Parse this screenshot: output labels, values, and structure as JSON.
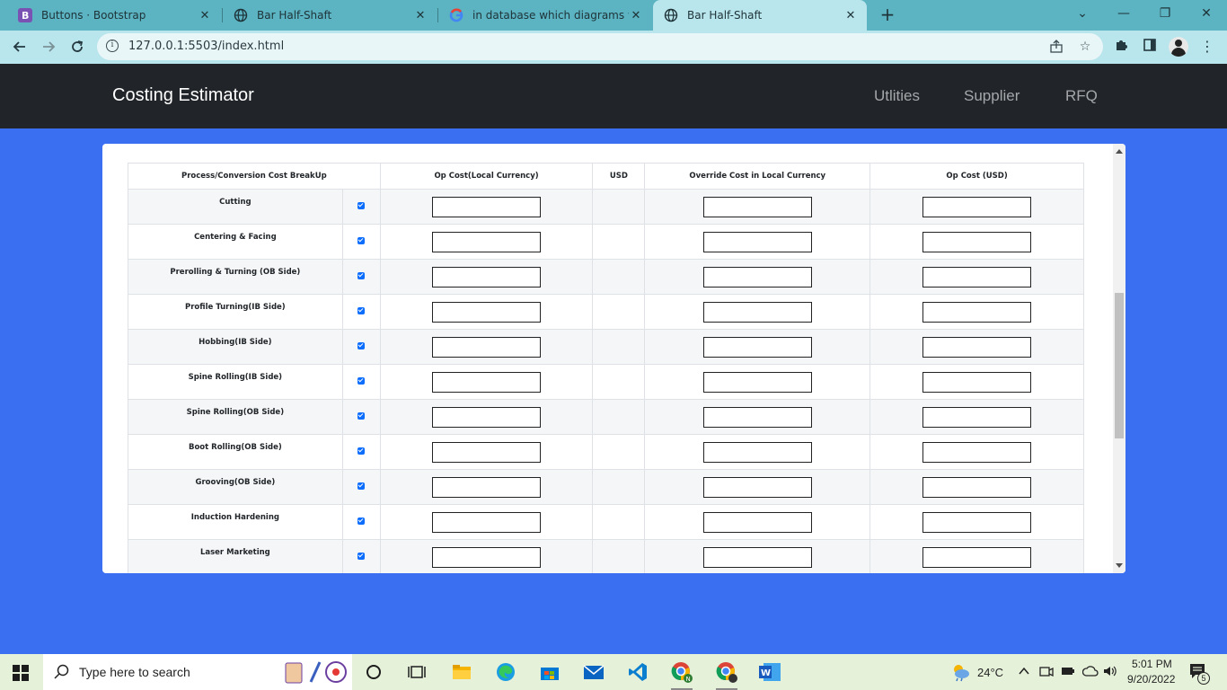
{
  "browser": {
    "tabs": [
      {
        "title": "Buttons · Bootstrap",
        "icon": "bootstrap-icon",
        "active": false
      },
      {
        "title": "Bar Half-Shaft",
        "icon": "globe-icon",
        "active": false
      },
      {
        "title": "in database which diagrams we w",
        "icon": "google-icon",
        "active": false
      },
      {
        "title": "Bar Half-Shaft",
        "icon": "globe-icon",
        "active": true
      }
    ],
    "close_glyph": "✕",
    "new_tab_glyph": "+",
    "controls": {
      "list": "⌄",
      "minimize": "—",
      "restore": "❐",
      "close": "✕"
    },
    "url": "127.0.0.1:5503/index.html",
    "info_glyph": "i"
  },
  "navbar": {
    "brand": "Costing Estimator",
    "links": [
      "Utlities",
      "Supplier",
      "RFQ"
    ]
  },
  "table": {
    "headers": {
      "process": "Process/Conversion Cost BreakUp",
      "op_cost_local": "Op Cost(Local Currency)",
      "usd": "USD",
      "override": "Override Cost in Local Currency",
      "op_cost_usd": "Op Cost (USD)"
    },
    "rows": [
      {
        "process": "Cutting",
        "checked": true,
        "op_cost_local": "",
        "usd": "",
        "override": "",
        "op_cost_usd": ""
      },
      {
        "process": "Centering & Facing",
        "checked": true,
        "op_cost_local": "",
        "usd": "",
        "override": "",
        "op_cost_usd": ""
      },
      {
        "process": "Prerolling & Turning (OB Side)",
        "checked": true,
        "op_cost_local": "",
        "usd": "",
        "override": "",
        "op_cost_usd": ""
      },
      {
        "process": "Profile Turning(IB Side)",
        "checked": true,
        "op_cost_local": "",
        "usd": "",
        "override": "",
        "op_cost_usd": ""
      },
      {
        "process": "Hobbing(IB Side)",
        "checked": true,
        "op_cost_local": "",
        "usd": "",
        "override": "",
        "op_cost_usd": ""
      },
      {
        "process": "Spine Rolling(IB Side)",
        "checked": true,
        "op_cost_local": "",
        "usd": "",
        "override": "",
        "op_cost_usd": ""
      },
      {
        "process": "Spine Rolling(OB Side)",
        "checked": true,
        "op_cost_local": "",
        "usd": "",
        "override": "",
        "op_cost_usd": ""
      },
      {
        "process": "Boot Rolling(OB Side)",
        "checked": true,
        "op_cost_local": "",
        "usd": "",
        "override": "",
        "op_cost_usd": ""
      },
      {
        "process": "Grooving(OB Side)",
        "checked": true,
        "op_cost_local": "",
        "usd": "",
        "override": "",
        "op_cost_usd": ""
      },
      {
        "process": "Induction Hardening",
        "checked": true,
        "op_cost_local": "",
        "usd": "",
        "override": "",
        "op_cost_usd": ""
      },
      {
        "process": "Laser Marketing",
        "checked": true,
        "op_cost_local": "",
        "usd": "",
        "override": "",
        "op_cost_usd": ""
      }
    ]
  },
  "taskbar": {
    "search_placeholder": "Type here to search",
    "weather": "24°C",
    "time": "5:01 PM",
    "date": "9/20/2022",
    "notification_count": "5",
    "apps": [
      "cortana-icon",
      "task-view-icon",
      "file-explorer-icon",
      "edge-icon",
      "store-icon",
      "mail-icon",
      "vscode-icon",
      "chrome-icon",
      "chrome-profile-icon",
      "word-icon"
    ],
    "colors": {
      "accent": "#3b6ff1",
      "navbar": "#212529",
      "checkbox": "#0d6efd"
    }
  }
}
